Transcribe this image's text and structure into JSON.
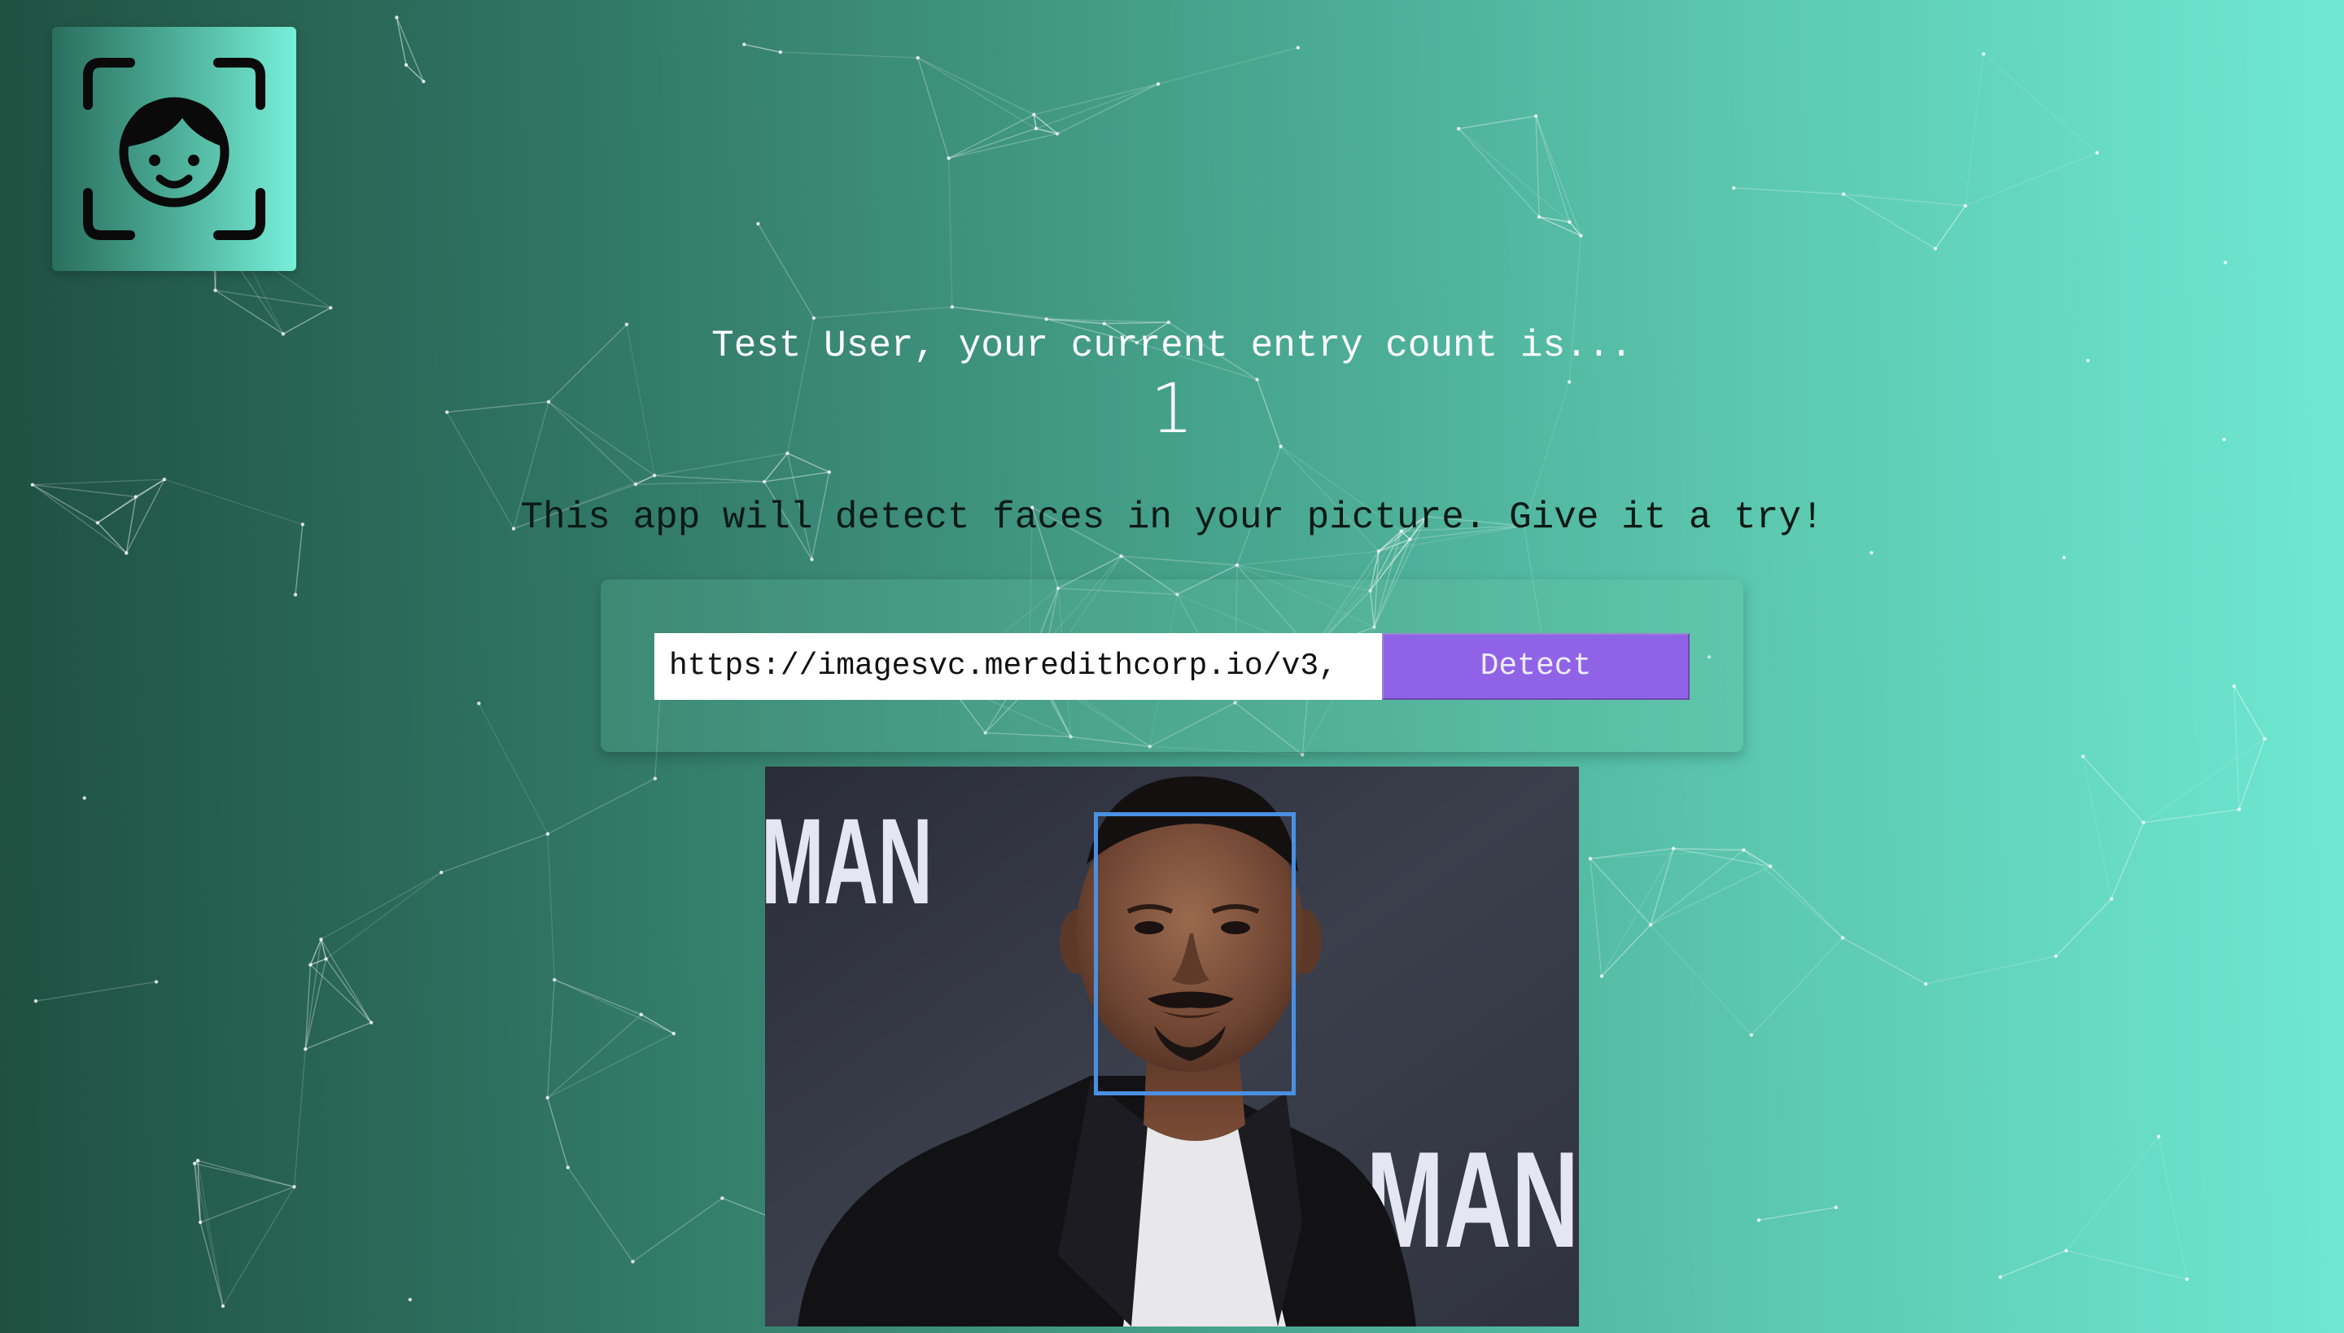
{
  "app": {
    "logo_icon": "face-scan-icon"
  },
  "greeting": {
    "user_name": "Test User",
    "text": "Test User, your current entry count is...",
    "entry_count": "1"
  },
  "intro": {
    "text": "This app will detect faces in your picture. Give it a try!"
  },
  "form": {
    "url_value": "https://imagesvc.meredithcorp.io/v3,",
    "detect_label": "Detect"
  },
  "image": {
    "background_text_left": "MAN",
    "background_text_right": "INI MAN",
    "detected_faces": 1,
    "box_color": "#4a90e2"
  },
  "colors": {
    "background_start": "#1f5040",
    "background_end": "#6fe8d2",
    "button": "#9063e6"
  }
}
